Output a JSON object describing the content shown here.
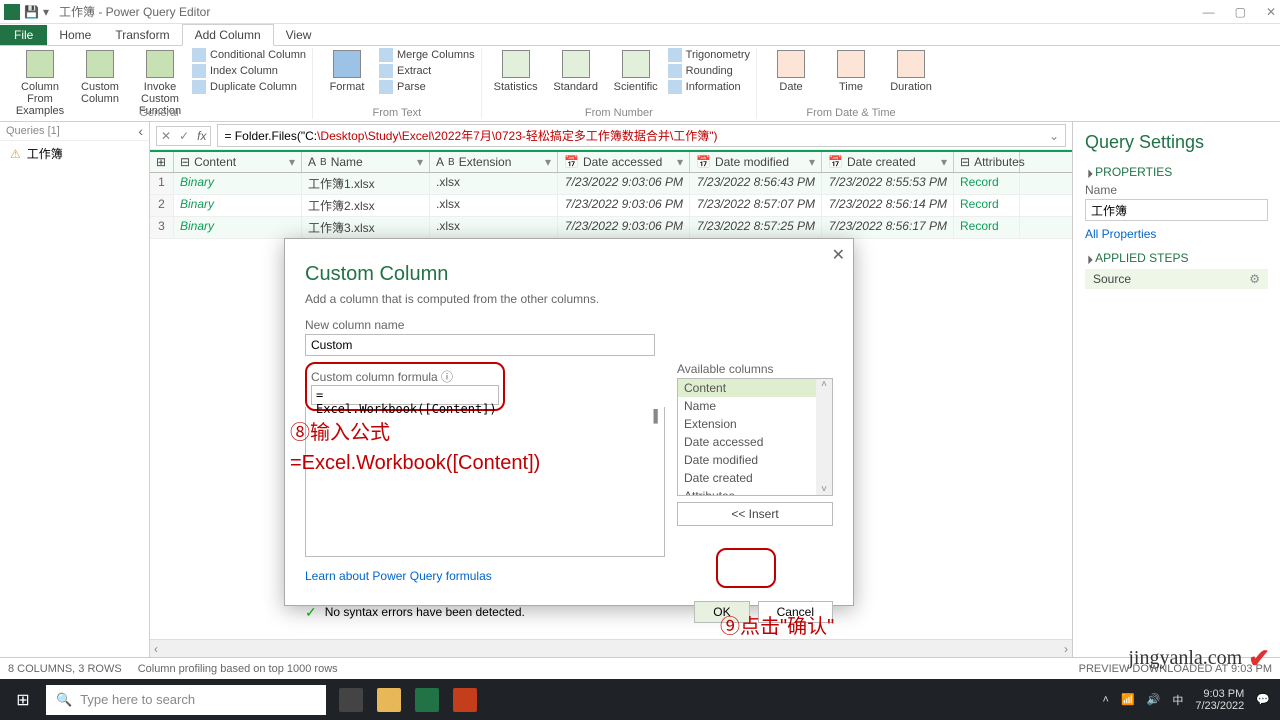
{
  "title": "工作簿 - Power Query Editor",
  "tabs": {
    "file": "File",
    "home": "Home",
    "transform": "Transform",
    "addcol": "Add Column",
    "view": "View"
  },
  "ribbon": {
    "general": {
      "label": "General",
      "colfrom": "Column From Examples",
      "custom": "Custom Column",
      "invoke": "Invoke Custom Function",
      "cond": "Conditional Column",
      "index": "Index Column",
      "dup": "Duplicate Column"
    },
    "fromtext": {
      "label": "From Text",
      "format": "Format",
      "merge": "Merge Columns",
      "extract": "Extract",
      "parse": "Parse"
    },
    "fromnum": {
      "label": "From Number",
      "stats": "Statistics",
      "standard": "Standard",
      "sci": "Scientific",
      "trig": "Trigonometry",
      "round": "Rounding",
      "info": "Information"
    },
    "fromdate": {
      "label": "From Date & Time",
      "date": "Date",
      "time": "Time",
      "duration": "Duration"
    }
  },
  "queries": {
    "hdr": "Queries [1]",
    "item": "工作簿"
  },
  "formula": {
    "left": "= Folder.Files(\"C:",
    "right": "\\Desktop\\Study\\Excel\\2022年7月\\0723-轻松搞定多工作簿数据合并\\工作簿\")"
  },
  "columns": [
    "Content",
    "Name",
    "Extension",
    "Date accessed",
    "Date modified",
    "Date created",
    "Attributes"
  ],
  "rows": [
    {
      "n": "1",
      "content": "Binary",
      "name": "工作簿1.xlsx",
      "ext": ".xlsx",
      "acc": "7/23/2022 9:03:06 PM",
      "mod": "7/23/2022 8:56:43 PM",
      "cre": "7/23/2022 8:55:53 PM",
      "attr": "Record"
    },
    {
      "n": "2",
      "content": "Binary",
      "name": "工作簿2.xlsx",
      "ext": ".xlsx",
      "acc": "7/23/2022 9:03:06 PM",
      "mod": "7/23/2022 8:57:07 PM",
      "cre": "7/23/2022 8:56:14 PM",
      "attr": "Record"
    },
    {
      "n": "3",
      "content": "Binary",
      "name": "工作簿3.xlsx",
      "ext": ".xlsx",
      "acc": "7/23/2022 9:03:06 PM",
      "mod": "7/23/2022 8:57:25 PM",
      "cre": "7/23/2022 8:56:17 PM",
      "attr": "Record"
    }
  ],
  "settings": {
    "title": "Query Settings",
    "props": "PROPERTIES",
    "name_lbl": "Name",
    "name_val": "工作簿",
    "allprops": "All Properties",
    "steps": "APPLIED STEPS",
    "step1": "Source"
  },
  "dialog": {
    "title": "Custom Column",
    "sub": "Add a column that is computed from the other columns.",
    "newcol_lbl": "New column name",
    "newcol_val": "Custom",
    "formula_lbl": "Custom column formula",
    "formula_val": "= Excel.Workbook([Content])",
    "avail_lbl": "Available columns",
    "avail": [
      "Content",
      "Name",
      "Extension",
      "Date accessed",
      "Date modified",
      "Date created",
      "Attributes"
    ],
    "insert": "<< Insert",
    "learn": "Learn about Power Query formulas",
    "status": "No syntax errors have been detected.",
    "ok": "OK",
    "cancel": "Cancel"
  },
  "annot": {
    "a1": "⑧输入公式",
    "a1b": "=Excel.Workbook([Content])",
    "a2": "⑨点击\"确认\""
  },
  "statusbar": {
    "left": "8 COLUMNS, 3 ROWS",
    "mid": "Column profiling based on top 1000 rows",
    "right": "PREVIEW DOWNLOADED AT 9:03 PM"
  },
  "taskbar": {
    "search": "Type here to search",
    "time": "9:03 PM",
    "date": "7/23/2022"
  },
  "watermark": "jingyanla.com"
}
